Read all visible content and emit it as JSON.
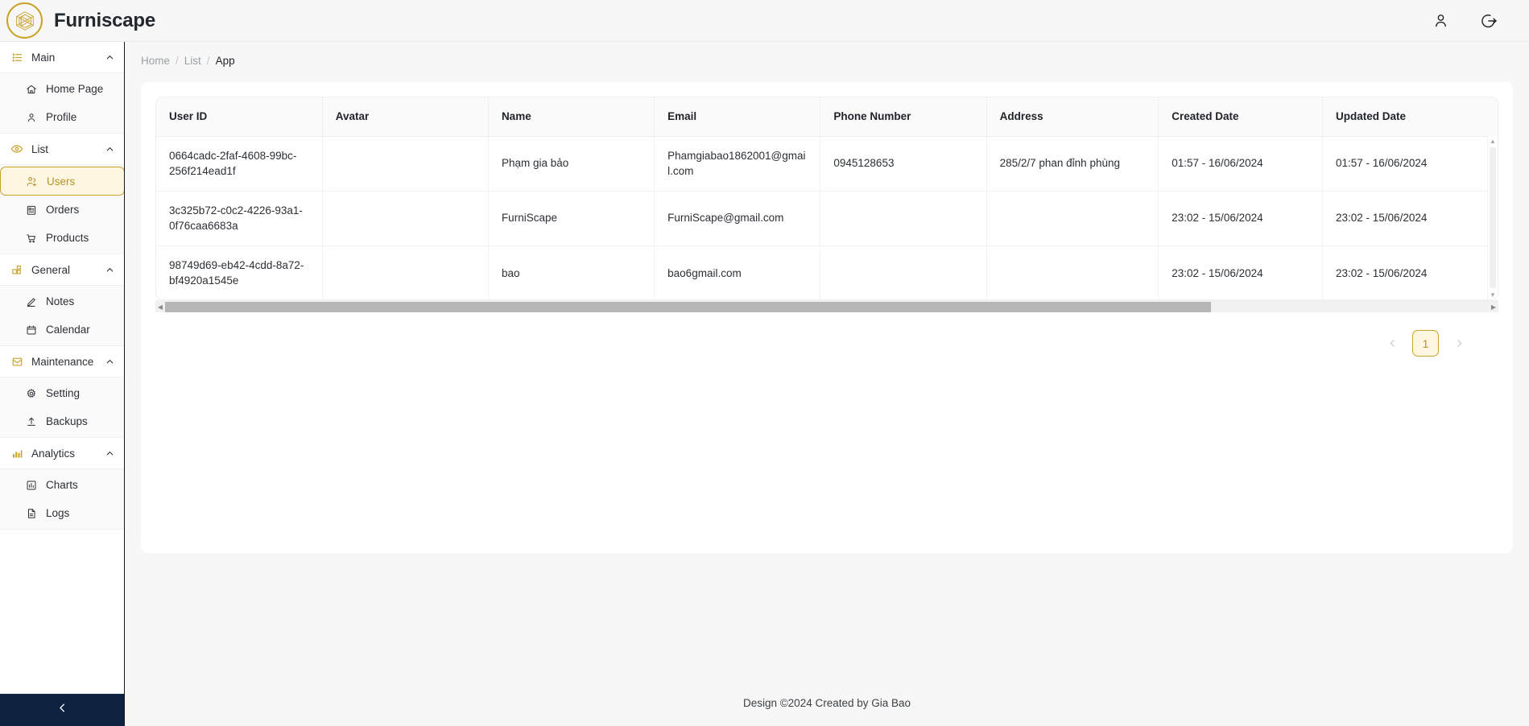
{
  "app": {
    "brand_name": "Furniscape",
    "logo_icon": "hexagon-geometric-logo"
  },
  "topbar": {
    "icons": [
      {
        "name": "user-account-icon",
        "label": "Account"
      },
      {
        "name": "logout-icon",
        "label": "Logout"
      }
    ]
  },
  "sidebar": {
    "groups": [
      {
        "label": "Main",
        "icon": "list-bullet-icon",
        "expanded": true,
        "caret": "▲",
        "items": [
          {
            "label": "Home Page",
            "icon": "home-icon",
            "active": false
          },
          {
            "label": "Profile",
            "icon": "user-icon",
            "active": false
          }
        ]
      },
      {
        "label": "List",
        "icon": "eye-icon",
        "expanded": true,
        "caret": "▲",
        "items": [
          {
            "label": "Users",
            "icon": "users-add-icon",
            "active": true
          },
          {
            "label": "Orders",
            "icon": "clipboard-orders-icon",
            "active": false
          },
          {
            "label": "Products",
            "icon": "shopping-cart-icon",
            "active": false
          }
        ]
      },
      {
        "label": "General",
        "icon": "apps-grid-icon",
        "expanded": true,
        "caret": "▲",
        "items": [
          {
            "label": "Notes",
            "icon": "pencil-edit-icon",
            "active": false
          },
          {
            "label": "Calendar",
            "icon": "calendar-icon",
            "active": false
          }
        ]
      },
      {
        "label": "Maintenance",
        "icon": "inbox-envelope-icon",
        "expanded": true,
        "caret": "▲",
        "items": [
          {
            "label": "Setting",
            "icon": "gear-icon",
            "active": false
          },
          {
            "label": "Backups",
            "icon": "upload-icon",
            "active": false
          }
        ]
      },
      {
        "label": "Analytics",
        "icon": "bar-chart-icon",
        "expanded": true,
        "caret": "▲",
        "items": [
          {
            "label": "Charts",
            "icon": "chart-bars-icon",
            "active": false
          },
          {
            "label": "Logs",
            "icon": "document-lines-icon",
            "active": false
          }
        ]
      }
    ],
    "collapse_icon": "chevron-left-icon"
  },
  "breadcrumb": {
    "items": [
      "Home",
      "List",
      "App"
    ],
    "separator": "/"
  },
  "table": {
    "columns": [
      "User ID",
      "Avatar",
      "Name",
      "Email",
      "Phone Number",
      "Address",
      "Created Date",
      "Updated Date"
    ],
    "rows": [
      {
        "user_id": "0664cadc-2faf-4608-99bc-256f214ead1f",
        "avatar": "",
        "name": "Phạm gia bảo",
        "email": "Phamgiabao1862001@gmail.com",
        "phone": "0945128653",
        "address": "285/2/7 phan đỉnh phùng",
        "created": "01:57 - 16/06/2024",
        "updated": "01:57 - 16/06/2024"
      },
      {
        "user_id": "3c325b72-c0c2-4226-93a1-0f76caa6683a",
        "avatar": "",
        "name": "FurniScape",
        "email": "FurniScape@gmail.com",
        "phone": "",
        "address": "",
        "created": "23:02 - 15/06/2024",
        "updated": "23:02 - 15/06/2024"
      },
      {
        "user_id": "98749d69-eb42-4cdd-8a72-bf4920a1545e",
        "avatar": "",
        "name": "bao",
        "email": "bao6gmail.com",
        "phone": "",
        "address": "",
        "created": "23:02 - 15/06/2024",
        "updated": "23:02 - 15/06/2024"
      }
    ]
  },
  "pagination": {
    "prev_icon": "chevron-left-icon",
    "next_icon": "chevron-right-icon",
    "current_page": "1"
  },
  "footer": {
    "text": "Design ©2024 Created by Gia Bao"
  },
  "colors": {
    "accent_gold": "#c9a227",
    "accent_gold_text": "#b8912a",
    "accent_gold_bg": "#fdf6e0",
    "dark_navy": "#0f2240",
    "page_bg": "#f7f7f7"
  }
}
